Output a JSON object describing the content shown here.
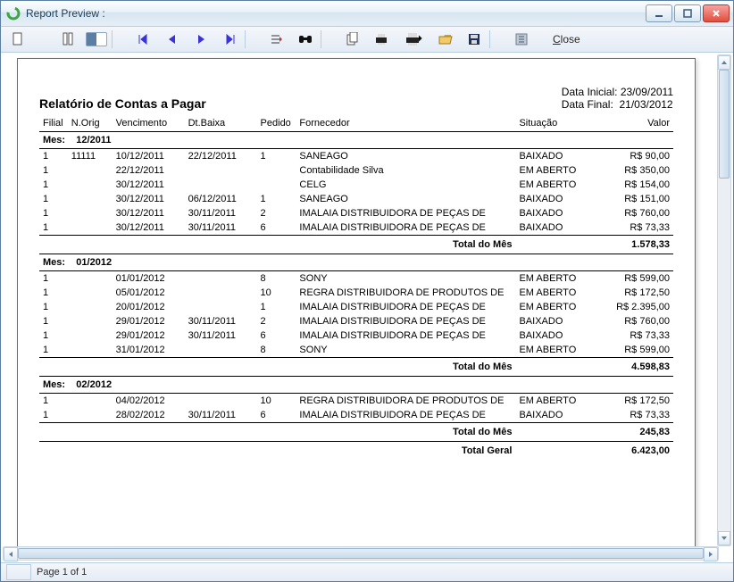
{
  "window": {
    "title": "Report Preview :"
  },
  "toolbar": {
    "close_label": "Close",
    "close_underline_index": 0
  },
  "status": {
    "page_label": "Page 1 of 1"
  },
  "report": {
    "title": "Relatório de Contas a Pagar",
    "date_start_label": "Data Inicial:",
    "date_start": "23/09/2011",
    "date_end_label": "Data Final:",
    "date_end": "21/03/2012",
    "headers": {
      "filial": "Filial",
      "norig": "N.Orig",
      "venc": "Vencimento",
      "baixa": "Dt.Baixa",
      "pedido": "Pedido",
      "fornecedor": "Fornecedor",
      "situacao": "Situação",
      "valor": "Valor"
    },
    "mes_label": "Mes:",
    "total_mes_label": "Total do Mês",
    "total_geral_label": "Total Geral",
    "total_geral": "6.423,00",
    "groups": [
      {
        "mes": "12/2011",
        "rows": [
          {
            "filial": "1",
            "norig": "11111",
            "venc": "10/12/2011",
            "baixa": "22/12/2011",
            "pedido": "1",
            "forn": "SANEAGO",
            "sit": "BAIXADO",
            "valor": "R$ 90,00"
          },
          {
            "filial": "1",
            "norig": "",
            "venc": "22/12/2011",
            "baixa": "",
            "pedido": "",
            "forn": "Contabilidade Silva",
            "sit": "EM ABERTO",
            "valor": "R$ 350,00"
          },
          {
            "filial": "1",
            "norig": "",
            "venc": "30/12/2011",
            "baixa": "",
            "pedido": "",
            "forn": "CELG",
            "sit": "EM ABERTO",
            "valor": "R$ 154,00"
          },
          {
            "filial": "1",
            "norig": "",
            "venc": "30/12/2011",
            "baixa": "06/12/2011",
            "pedido": "1",
            "forn": "SANEAGO",
            "sit": "BAIXADO",
            "valor": "R$ 151,00"
          },
          {
            "filial": "1",
            "norig": "",
            "venc": "30/12/2011",
            "baixa": "30/11/2011",
            "pedido": "2",
            "forn": "IMALAIA DISTRIBUIDORA DE PEÇAS DE",
            "sit": "BAIXADO",
            "valor": "R$ 760,00"
          },
          {
            "filial": "1",
            "norig": "",
            "venc": "30/12/2011",
            "baixa": "30/11/2011",
            "pedido": "6",
            "forn": "IMALAIA DISTRIBUIDORA DE PEÇAS DE",
            "sit": "BAIXADO",
            "valor": "R$ 73,33"
          }
        ],
        "total": "1.578,33"
      },
      {
        "mes": "01/2012",
        "rows": [
          {
            "filial": "1",
            "norig": "",
            "venc": "01/01/2012",
            "baixa": "",
            "pedido": "8",
            "forn": "SONY",
            "sit": "EM ABERTO",
            "valor": "R$ 599,00"
          },
          {
            "filial": "1",
            "norig": "",
            "venc": "05/01/2012",
            "baixa": "",
            "pedido": "10",
            "forn": "REGRA DISTRIBUIDORA DE PRODUTOS DE",
            "sit": "EM ABERTO",
            "valor": "R$ 172,50"
          },
          {
            "filial": "1",
            "norig": "",
            "venc": "20/01/2012",
            "baixa": "",
            "pedido": "1",
            "forn": "IMALAIA DISTRIBUIDORA DE PEÇAS DE",
            "sit": "EM ABERTO",
            "valor": "R$ 2.395,00"
          },
          {
            "filial": "1",
            "norig": "",
            "venc": "29/01/2012",
            "baixa": "30/11/2011",
            "pedido": "2",
            "forn": "IMALAIA DISTRIBUIDORA DE PEÇAS DE",
            "sit": "BAIXADO",
            "valor": "R$ 760,00"
          },
          {
            "filial": "1",
            "norig": "",
            "venc": "29/01/2012",
            "baixa": "30/11/2011",
            "pedido": "6",
            "forn": "IMALAIA DISTRIBUIDORA DE PEÇAS DE",
            "sit": "BAIXADO",
            "valor": "R$ 73,33"
          },
          {
            "filial": "1",
            "norig": "",
            "venc": "31/01/2012",
            "baixa": "",
            "pedido": "8",
            "forn": "SONY",
            "sit": "EM ABERTO",
            "valor": "R$ 599,00"
          }
        ],
        "total": "4.598,83"
      },
      {
        "mes": "02/2012",
        "rows": [
          {
            "filial": "1",
            "norig": "",
            "venc": "04/02/2012",
            "baixa": "",
            "pedido": "10",
            "forn": "REGRA DISTRIBUIDORA DE PRODUTOS DE",
            "sit": "EM ABERTO",
            "valor": "R$ 172,50"
          },
          {
            "filial": "1",
            "norig": "",
            "venc": "28/02/2012",
            "baixa": "30/11/2011",
            "pedido": "6",
            "forn": "IMALAIA DISTRIBUIDORA DE PEÇAS DE",
            "sit": "BAIXADO",
            "valor": "R$ 73,33"
          }
        ],
        "total": "245,83"
      }
    ]
  }
}
